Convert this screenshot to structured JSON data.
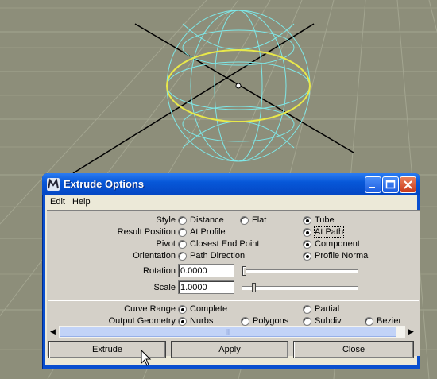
{
  "colors": {
    "viewport_bg": "#8d8e7a",
    "grid_line": "#a0a28c",
    "wire": "#7ee8e8",
    "selected_curve": "#e8e84a",
    "titlebar": "#0757d8"
  },
  "window": {
    "title": "Extrude Options",
    "app_icon": "maya-icon"
  },
  "menubar": {
    "edit": "Edit",
    "help": "Help"
  },
  "style": {
    "label": "Style",
    "options": [
      "Distance",
      "Flat",
      "Tube"
    ],
    "selected": "Tube"
  },
  "result_position": {
    "label": "Result Position",
    "options": [
      "At Profile",
      "At Path"
    ],
    "selected": "At Path"
  },
  "pivot": {
    "label": "Pivot",
    "options": [
      "Closest End Point",
      "Component"
    ],
    "selected": "Component"
  },
  "orientation": {
    "label": "Orientation",
    "options": [
      "Path Direction",
      "Profile Normal"
    ],
    "selected": "Profile Normal"
  },
  "rotation": {
    "label": "Rotation",
    "value": "0.0000",
    "slider_fraction": 0.0
  },
  "scale": {
    "label": "Scale",
    "value": "1.0000",
    "slider_fraction": 0.08
  },
  "curve_range": {
    "label": "Curve Range",
    "options": [
      "Complete",
      "Partial"
    ],
    "selected": "Complete"
  },
  "output_geometry": {
    "label": "Output Geometry",
    "options": [
      "Nurbs",
      "Polygons",
      "Subdiv",
      "Bezier"
    ],
    "selected": "Nurbs"
  },
  "buttons": {
    "extrude": "Extrude",
    "apply": "Apply",
    "close": "Close"
  }
}
